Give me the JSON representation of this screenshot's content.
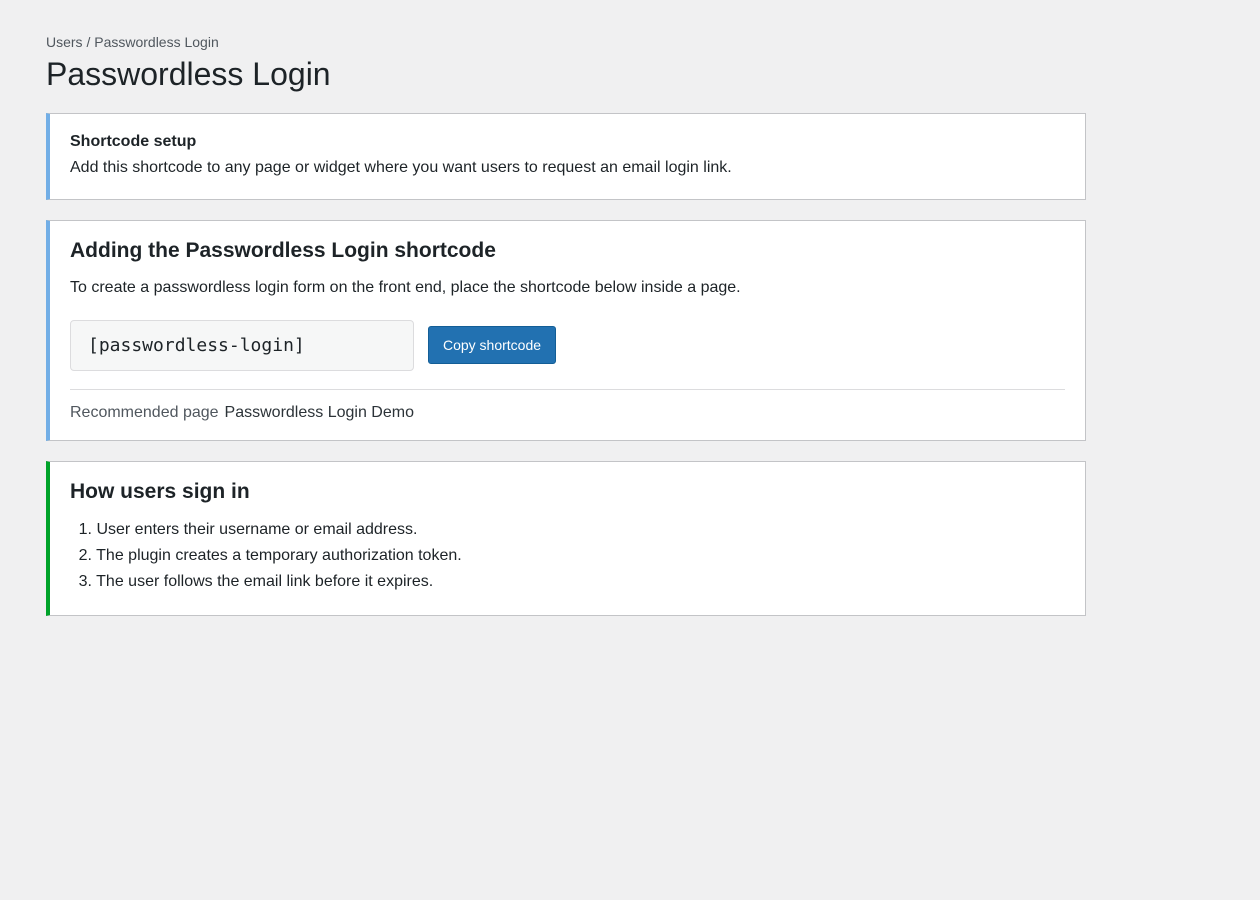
{
  "breadcrumb": "Users / Passwordless Login",
  "page_title": "Passwordless Login",
  "notice": {
    "title": "Shortcode setup",
    "text": "Add this shortcode to any page or widget where you want users to request an email login link."
  },
  "shortcode_card": {
    "title": "Adding the Passwordless Login shortcode",
    "description": "To create a passwordless login form on the front end, place the shortcode below inside a page.",
    "shortcode": "[passwordless-login]",
    "copy_button_label": "Copy shortcode",
    "recommended_label": "Recommended page",
    "recommended_value": "Passwordless Login Demo"
  },
  "howto_card": {
    "title": "How users sign in",
    "steps": [
      {
        "num": "1.",
        "text": "User enters their username or email address."
      },
      {
        "num": "2.",
        "text": "The plugin creates a temporary authorization token."
      },
      {
        "num": "3.",
        "text": "The user follows the email link before it expires."
      }
    ]
  },
  "colors": {
    "background": "#f0f0f1",
    "info_accent": "#72aee6",
    "success_accent": "#00a32a",
    "primary_button": "#2271b1"
  }
}
